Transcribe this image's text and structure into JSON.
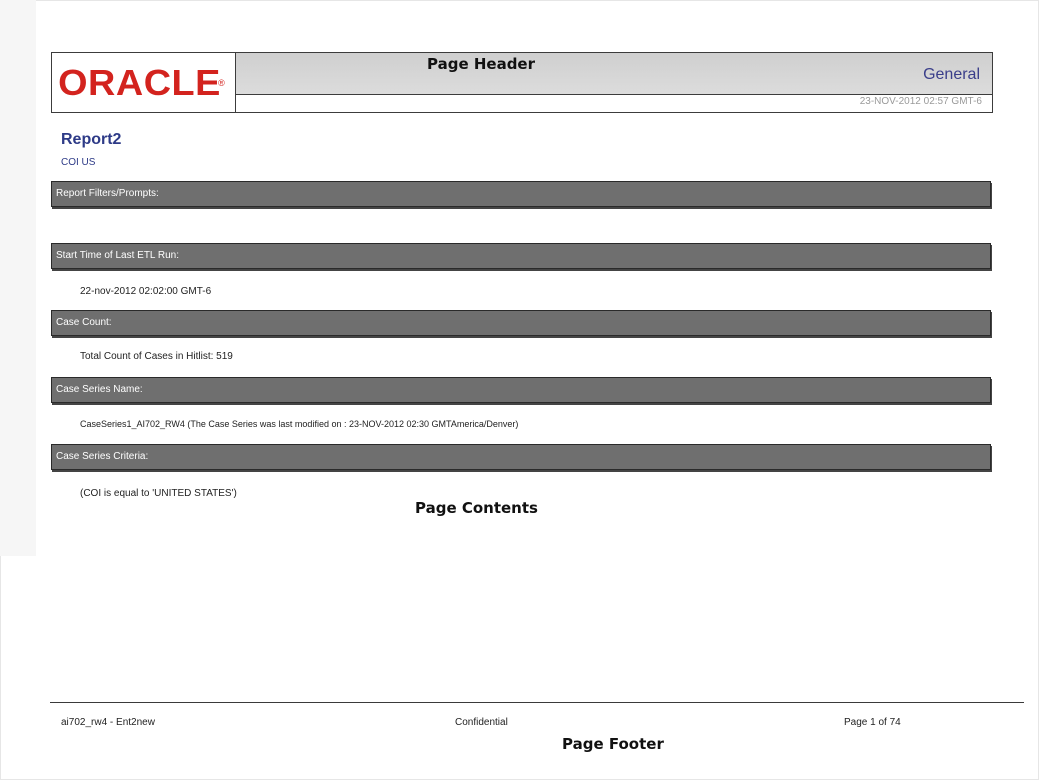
{
  "header": {
    "logo": "ORACLE",
    "logo_tm": "®",
    "label": "Page Header",
    "category": "General",
    "timestamp": "23-NOV-2012 02:57 GMT-6"
  },
  "report": {
    "title": "Report2",
    "subtitle": "COI US"
  },
  "sections": [
    {
      "heading": "Report Filters/Prompts:",
      "content": ""
    },
    {
      "heading": "Start Time of Last ETL Run:",
      "content": "22-nov-2012 02:02:00 GMT-6"
    },
    {
      "heading": "Case Count:",
      "content": "Total Count of Cases in Hitlist: 519"
    },
    {
      "heading": "Case Series Name:",
      "content": "CaseSeries1_AI702_RW4 (The Case Series was last modified on : 23-NOV-2012 02:30 GMTAmerica/Denver)"
    },
    {
      "heading": "Case Series Criteria:",
      "content": "(COI is equal to 'UNITED STATES')"
    }
  ],
  "contents_label": "Page Contents",
  "footer": {
    "left": "ai702_rw4 - Ent2new",
    "center": "Confidential",
    "right": "Page 1 of 74",
    "label": "Page Footer"
  },
  "colors": {
    "logo_red": "#d3231e",
    "title_blue": "#2d3a87",
    "section_bar": "#6f6f6f"
  }
}
